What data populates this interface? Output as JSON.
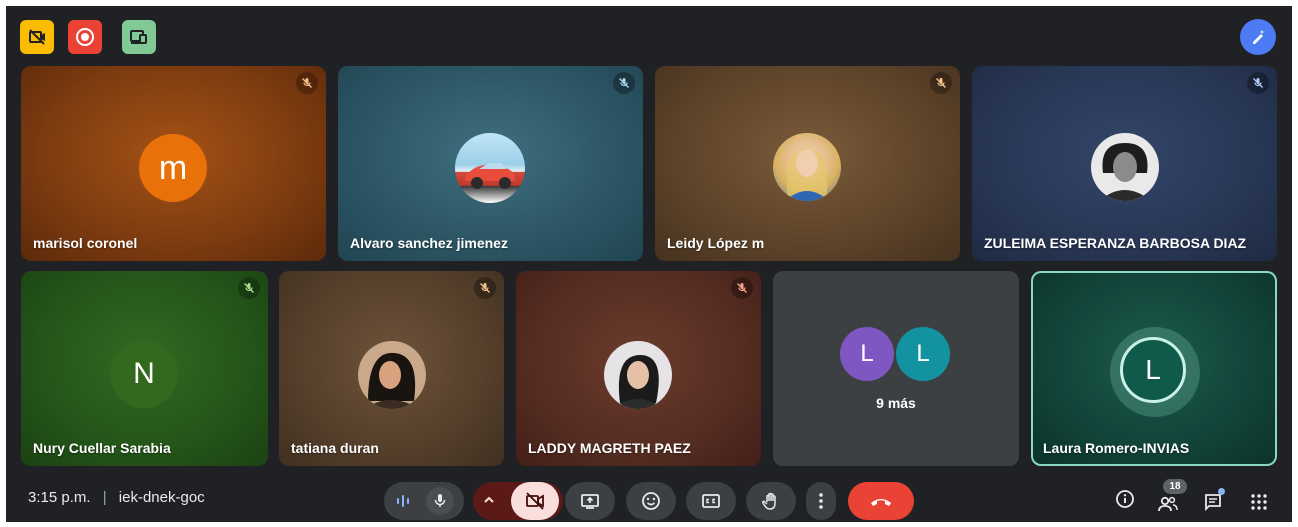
{
  "participants": [
    {
      "name": "marisol coronel",
      "initial": "m",
      "muted": true
    },
    {
      "name": "Alvaro sanchez jimenez",
      "muted": true
    },
    {
      "name": "Leidy López m",
      "muted": true
    },
    {
      "name": "ZULEIMA ESPERANZA BARBOSA DIAZ",
      "muted": true
    },
    {
      "name": "Nury Cuellar Sarabia",
      "initial": "N",
      "muted": true
    },
    {
      "name": "tatiana duran",
      "muted": true
    },
    {
      "name": "LADDY MAGRETH PAEZ",
      "muted": true
    },
    {
      "name": "Laura Romero-INVIAS",
      "initial": "L",
      "speaking": true
    }
  ],
  "overflow_tile": {
    "initials": [
      "L",
      "L"
    ],
    "label": "9 más"
  },
  "bottom_bar": {
    "time": "3:15 p.m.",
    "separator": "|",
    "meeting_code": "iek-dnek-goc"
  },
  "participants_badge": "18",
  "colors": {
    "background": "#202124",
    "end_call": "#ea4335",
    "camera_off": "#f9dedc",
    "accent_teal": "#81c995"
  }
}
